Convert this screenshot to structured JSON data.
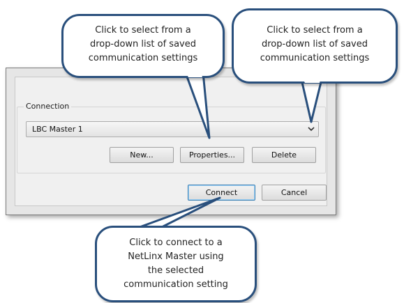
{
  "dialog": {
    "group_label": "Connection",
    "combo_value": "LBC Master 1",
    "buttons": {
      "new": "New...",
      "properties": "Properties...",
      "delete": "Delete",
      "connect": "Connect",
      "cancel": "Cancel"
    }
  },
  "callouts": {
    "left": {
      "lines": [
        "Click to select from a",
        "drop-down list of saved",
        "communication settings"
      ]
    },
    "right": {
      "lines": [
        "Click to select from a",
        "drop-down list of saved",
        "communication settings"
      ]
    },
    "bottom": {
      "lines": [
        "Click to connect to a",
        "NetLinx Master using",
        "the selected",
        "communication setting"
      ]
    }
  },
  "colors": {
    "callout_border": "#294f7c",
    "default_button_border": "#3c7fb1"
  }
}
